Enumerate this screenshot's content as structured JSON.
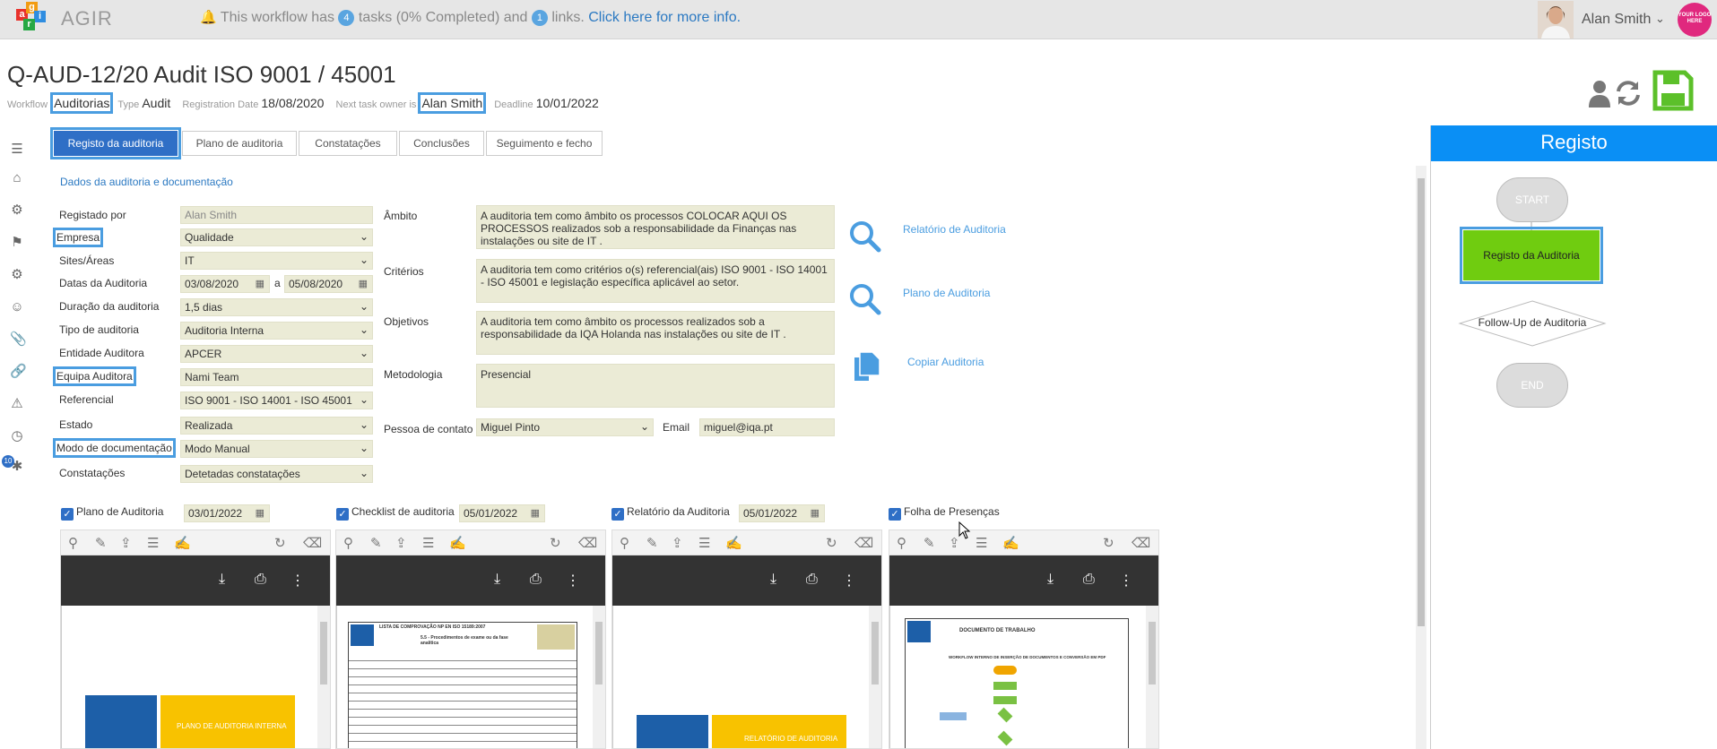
{
  "topbar": {
    "logo_letters": [
      "a",
      "g",
      "i",
      "r"
    ],
    "app_name": "AGIR",
    "notice_pre": "This workflow has",
    "tasks_count": "4",
    "notice_mid": "tasks (0% Completed) and",
    "links_count": "1",
    "notice_post": "links.",
    "notice_link": "Click here for more info.",
    "user_name": "Alan Smith",
    "brand_logo_text": "YOUR LOGO HERE"
  },
  "header": {
    "title": "Q-AUD-12/20 Audit ISO 9001 / 45001",
    "workflow_label": "Workflow",
    "workflow_value": "Auditorias",
    "type_label": "Type",
    "type_value": "Audit",
    "reg_label": "Registration Date",
    "reg_value": "18/08/2020",
    "owner_label": "Next task owner is",
    "owner_value": "Alan Smith",
    "deadline_label": "Deadline",
    "deadline_value": "10/01/2022"
  },
  "nav": {
    "badge": "10"
  },
  "tabs": [
    "Registo da auditoria",
    "Plano de auditoria",
    "Constatações",
    "Conclusões",
    "Seguimento e fecho"
  ],
  "section_title": "Dados da auditoria e documentação",
  "form": {
    "registado_por": {
      "label": "Registado por",
      "value": "Alan Smith"
    },
    "empresa": {
      "label": "Empresa",
      "value": "Qualidade"
    },
    "sites": {
      "label": "Sites/Áreas",
      "value": "IT"
    },
    "datas": {
      "label": "Datas da Auditoria",
      "from": "03/08/2020",
      "sep": "a",
      "to": "05/08/2020"
    },
    "duracao": {
      "label": "Duração da auditoria",
      "value": "1,5 dias"
    },
    "tipo": {
      "label": "Tipo de auditoria",
      "value": "Auditoria Interna"
    },
    "entidade": {
      "label": "Entidade Auditora",
      "value": "APCER"
    },
    "equipa": {
      "label": "Equipa Auditora",
      "value": "Nami Team"
    },
    "referencial": {
      "label": "Referencial",
      "value": "ISO 9001 - ISO 14001 - ISO 45001"
    },
    "estado": {
      "label": "Estado",
      "value": "Realizada"
    },
    "modo": {
      "label": "Modo de documentação",
      "value": "Modo Manual"
    },
    "constatacoes": {
      "label": "Constatações",
      "value": "Detetadas constatações"
    },
    "ambito": {
      "label": "Âmbito",
      "value": "A auditoria tem como âmbito os processos COLOCAR AQUI OS PROCESSOS realizados sob a responsabilidade da Finanças nas instalações ou site de IT ."
    },
    "criterios": {
      "label": "Critérios",
      "value": "A auditoria tem como critérios o(s) referencial(ais) ISO 9001 - ISO 14001 - ISO 45001 e legislação específica aplicável ao setor."
    },
    "objetivos": {
      "label": "Objetivos",
      "value": "A auditoria tem como âmbito os processos realizados sob a responsabilidade da IQA Holanda nas instalações ou site de IT ."
    },
    "metodologia": {
      "label": "Metodologia",
      "value": "Presencial"
    },
    "contacto": {
      "label": "Pessoa de contato",
      "value": "Miguel Pinto"
    },
    "email": {
      "label": "Email",
      "value": "miguel@iqa.pt"
    }
  },
  "doc_links": [
    "Relatório de Auditoria",
    "Plano de Auditoria",
    "Copiar Auditoria"
  ],
  "attachments": [
    {
      "label": "Plano de Auditoria",
      "date": "03/01/2022",
      "preview_text": "PLANO DE AUDITORIA INTERNA"
    },
    {
      "label": "Checklist de auditoria",
      "date": "05/01/2022",
      "preview_title": "LISTA DE COMPROVAÇÃO NP EN ISO 15189:2007",
      "preview_sub": "5.5 - Procedimentos de exame ou da fase analítica"
    },
    {
      "label": "Relatório da Auditoria",
      "date": "05/01/2022",
      "preview_text": "RELATÓRIO DE AUDITORIA"
    },
    {
      "label": "Folha de Presenças",
      "date": "",
      "preview_title": "DOCUMENTO DE TRABALHO",
      "preview_sub": "WORKFLOW INTERNO DE INSERÇÃO DE DOCUMENTOS E CONVERSÃO EM PDF"
    }
  ],
  "workflow_panel": {
    "title": "Registo",
    "start": "START",
    "step1": "Registo da Auditoria",
    "step2": "Follow-Up de Auditoria",
    "end": "END"
  },
  "colors": {
    "accent": "#0a8ff5",
    "active_tab": "#2f6fc6",
    "field_bg": "#ebebd6",
    "green_step": "#70cc10",
    "save_green": "#5cc02a"
  }
}
